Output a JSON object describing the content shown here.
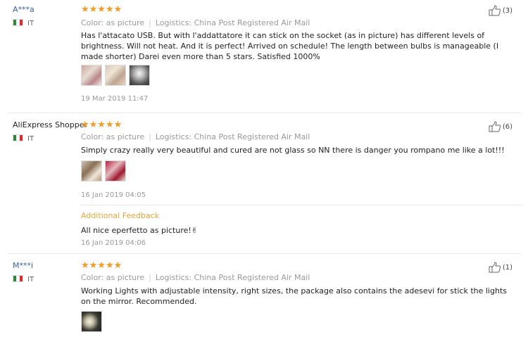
{
  "colors": {
    "star": "#f59a23",
    "username": "#3a5fa6",
    "meta": "#999999",
    "additional": "#e8a43a"
  },
  "reviews": [
    {
      "user": "A***a",
      "country": "IT",
      "stars": "★★★★★",
      "color_label": "Color: as picture",
      "logistics_label": "Logistics: China Post Registered Air Mail",
      "text": "Has l'attacato USB. But with l'addattatore it can stick on the socket (as in picture) has different levels of brightness. Will not heat. And it is perfect! Arrived on schedule! The length between bulbs is manageable (I made shorter) Darei even more than 5 stars. Satisfied 1000%",
      "date": "19 Mar 2019 11:47",
      "helpful": "(3)"
    },
    {
      "user": "AliExpress Shopper",
      "country": "IT",
      "stars": "★★★★★",
      "color_label": "Color: as picture",
      "logistics_label": "Logistics: China Post Registered Air Mail",
      "text": "Simply crazy really very beautiful and cured are not glass so NN there is danger you rompano me like a lot!!!",
      "date": "16 Jan 2019 04:05",
      "additional_label": "Additional Feedback",
      "additional_text": "All nice eperfetto as picture!✌",
      "additional_date": "16 Jan 2019 04:06",
      "helpful": "(6)"
    },
    {
      "user": "M***i",
      "country": "IT",
      "stars": "★★★★★",
      "color_label": "Color: as picture",
      "logistics_label": "Logistics: China Post Registered Air Mail",
      "text": "Working Lights with adjustable intensity, right sizes, the package also contains the adesevi for stick the lights on the mirror. Recommended.",
      "helpful": "(1)"
    }
  ]
}
